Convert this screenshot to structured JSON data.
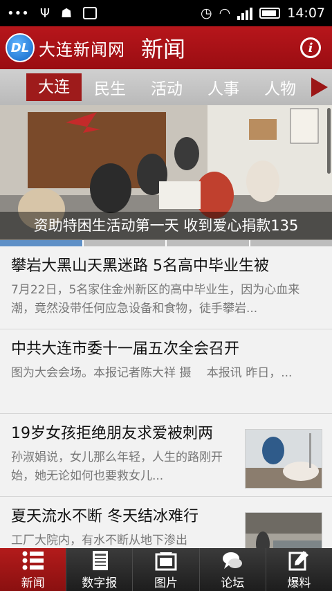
{
  "status": {
    "time": "14:07"
  },
  "app": {
    "logo_text": "大连新闻网",
    "logo_badge": "DL",
    "title": "新闻",
    "info_glyph": "i"
  },
  "tabs": [
    "大连",
    "民生",
    "活动",
    "人事",
    "人物"
  ],
  "banner": {
    "caption": "资助特困生活动第一天 收到爱心捐款135"
  },
  "news": [
    {
      "title": "攀岩大黑山天黑迷路 5名高中毕业生被",
      "summary": "7月22日，5名家住金州新区的高中毕业生，因为心血来潮，竟然没带任何应急设备和食物，徒手攀岩..."
    },
    {
      "title": "中共大连市委十一届五次全会召开",
      "summary": "图为大会会场。本报记者陈大祥 摄　 本报讯  昨日，..."
    },
    {
      "title": "19岁女孩拒绝朋友求爱被刺两",
      "summary": "孙淑娟说，女儿那么年轻，人生的路刚开始，她无论如何也要救女儿..."
    },
    {
      "title": "夏天流水不断 冬天结冰难行",
      "summary": "工厂大院内，有水不断从地下渗出"
    }
  ],
  "nav": [
    {
      "label": "新闻",
      "icon": "list-icon"
    },
    {
      "label": "数字报",
      "icon": "newspaper-icon"
    },
    {
      "label": "图片",
      "icon": "picture-icon"
    },
    {
      "label": "论坛",
      "icon": "forum-icon"
    },
    {
      "label": "爆料",
      "icon": "edit-icon"
    }
  ]
}
